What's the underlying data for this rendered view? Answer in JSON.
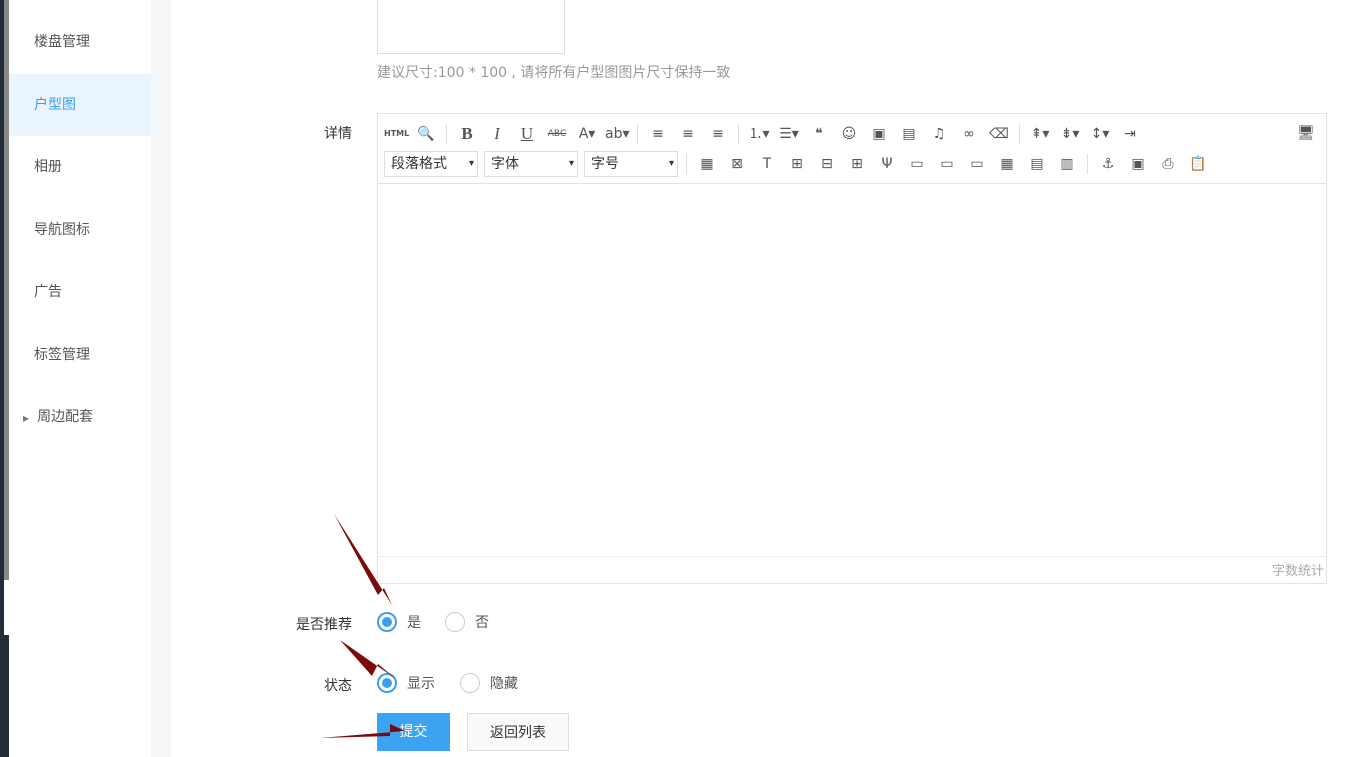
{
  "sidebar": {
    "items": [
      {
        "label": "楼盘管理"
      },
      {
        "label": "户型图",
        "active": true
      },
      {
        "label": "相册"
      },
      {
        "label": "导航图标"
      },
      {
        "label": "广告"
      },
      {
        "label": "标签管理"
      },
      {
        "label": "周边配套",
        "expandable": true
      }
    ]
  },
  "form": {
    "image_hint": "建议尺寸:100 * 100 , 请将所有户型图图片尺寸保持一致",
    "detail_label": "详情",
    "editor": {
      "row1": [
        {
          "name": "html",
          "g": "HTML"
        },
        {
          "name": "preview",
          "g": "🔍"
        },
        {
          "sep": true
        },
        {
          "name": "bold",
          "g": "B"
        },
        {
          "name": "italic",
          "g": "I"
        },
        {
          "name": "underline",
          "g": "U"
        },
        {
          "name": "strikethrough",
          "g": "ABC"
        },
        {
          "name": "font-color",
          "g": "A▾"
        },
        {
          "name": "highlight",
          "g": "ab▾"
        },
        {
          "sep": true
        },
        {
          "name": "align-left",
          "g": "≡"
        },
        {
          "name": "align-center",
          "g": "≡"
        },
        {
          "name": "align-right",
          "g": "≡"
        },
        {
          "sep": true
        },
        {
          "name": "ordered-list",
          "g": "⒈▾"
        },
        {
          "name": "unordered-list",
          "g": "☰▾"
        },
        {
          "name": "quote",
          "g": "❝"
        },
        {
          "name": "emoji",
          "g": "☺"
        },
        {
          "name": "image",
          "g": "▣"
        },
        {
          "name": "video",
          "g": "▤"
        },
        {
          "name": "music",
          "g": "♫"
        },
        {
          "name": "link",
          "g": "∞"
        },
        {
          "name": "eraser",
          "g": "⌫"
        },
        {
          "sep": true
        },
        {
          "name": "paragraph-spacing",
          "g": "⇞▾"
        },
        {
          "name": "row-spacing",
          "g": "⇟▾"
        },
        {
          "name": "line-height",
          "g": "↕▾"
        },
        {
          "name": "indent",
          "g": "⇥"
        }
      ],
      "row2_selects": [
        {
          "value": "段落格式"
        },
        {
          "value": "字体"
        },
        {
          "value": "字号"
        }
      ],
      "row2": [
        {
          "name": "insert-table",
          "g": "▦"
        },
        {
          "name": "delete-table",
          "g": "⊠"
        },
        {
          "name": "table-title",
          "g": "T"
        },
        {
          "name": "insert-row",
          "g": "⊞"
        },
        {
          "name": "delete-row",
          "g": "⊟"
        },
        {
          "name": "insert-col",
          "g": "⊞"
        },
        {
          "name": "delete-col",
          "g": "Ψ"
        },
        {
          "name": "merge-cells",
          "g": "▭"
        },
        {
          "name": "merge-right",
          "g": "▭"
        },
        {
          "name": "merge-down",
          "g": "▭"
        },
        {
          "name": "split-cells",
          "g": "▦"
        },
        {
          "name": "split-rows",
          "g": "▤"
        },
        {
          "name": "split-cols",
          "g": "▥"
        },
        {
          "sep": true
        },
        {
          "name": "anchor",
          "g": "⚓"
        },
        {
          "name": "template",
          "g": "▣"
        },
        {
          "name": "print",
          "g": "⎙"
        },
        {
          "name": "paste",
          "g": "📋"
        }
      ],
      "word_count": "字数统计"
    },
    "recommend_label": "是否推荐",
    "recommend_options": [
      "是",
      "否"
    ],
    "status_label": "状态",
    "status_options": [
      "显示",
      "隐藏"
    ],
    "submit": "提交",
    "back": "返回列表"
  },
  "colors": {
    "accent": "#3a9ff0",
    "arrow": "#7d0a0a"
  }
}
